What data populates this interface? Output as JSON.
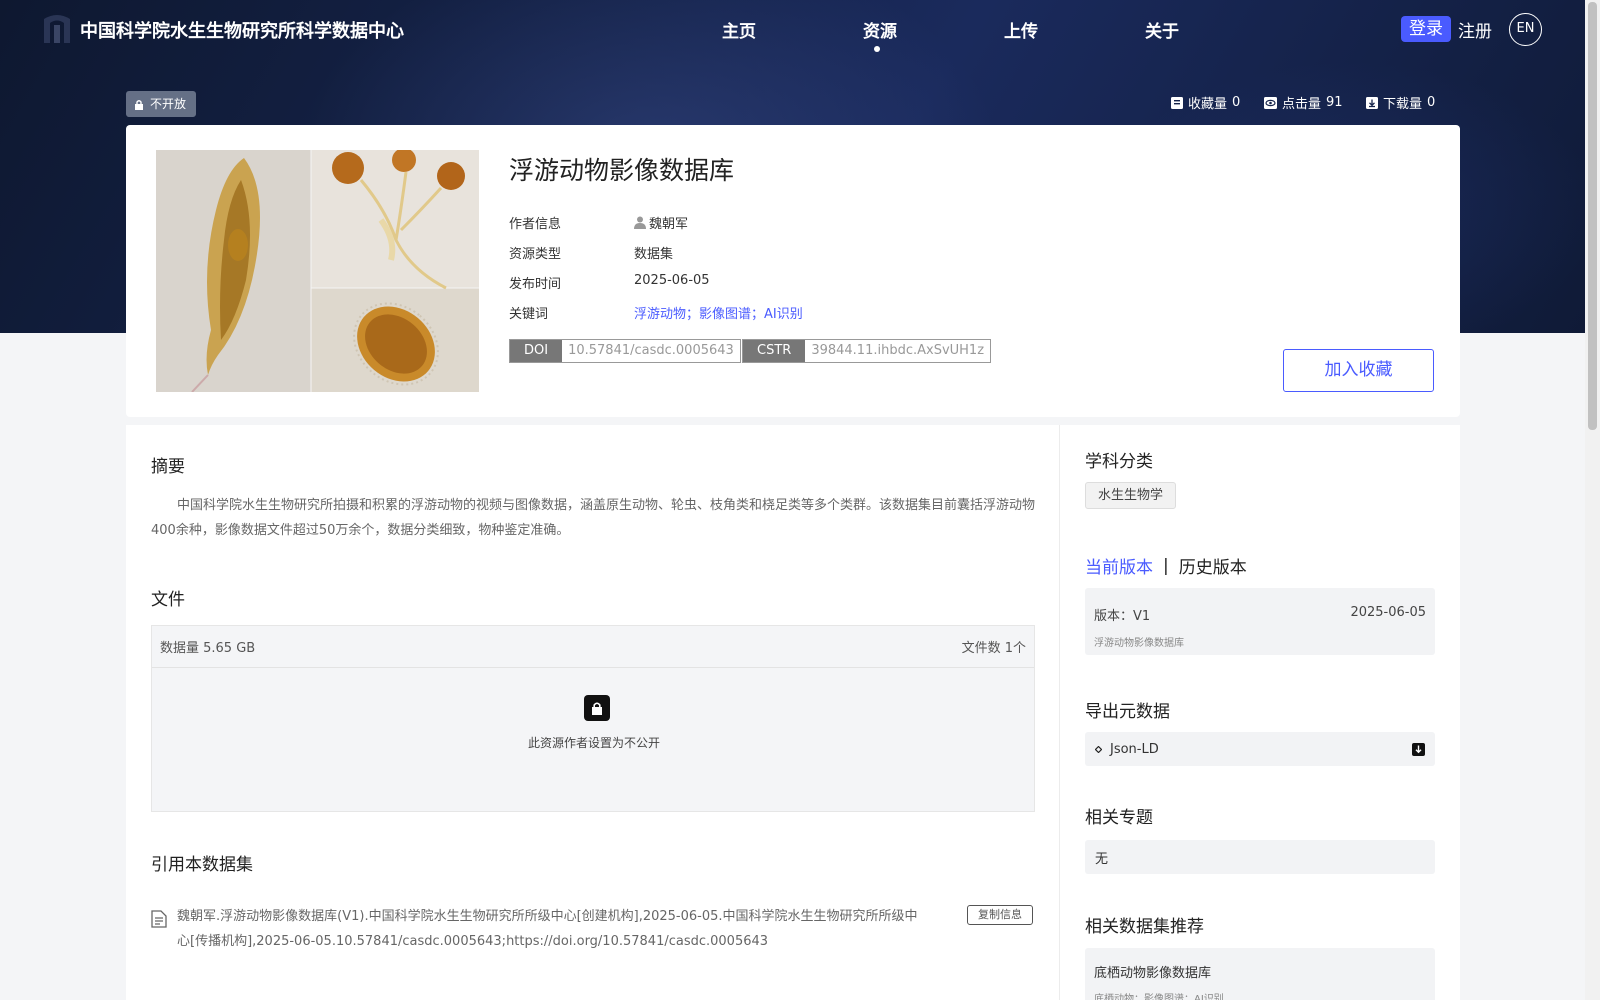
{
  "header": {
    "site_title": "中国科学院水生生物研究所科学数据中心",
    "nav": [
      "主页",
      "资源",
      "上传",
      "关于"
    ],
    "login": "登录",
    "register": "注册",
    "lang": "EN"
  },
  "resource": {
    "access_badge": "不开放",
    "stats": {
      "favorites_label": "收藏量",
      "favorites": "0",
      "clicks_label": "点击量",
      "clicks": "91",
      "downloads_label": "下载量",
      "downloads": "0"
    },
    "title": "浮游动物影像数据库",
    "meta": {
      "author_label": "作者信息",
      "author": "魏朝军",
      "type_label": "资源类型",
      "type": "数据集",
      "date_label": "发布时间",
      "date": "2025-06-05",
      "keywords_label": "关键词",
      "keywords": "浮游动物；影像图谱；AI识别"
    },
    "doi_label": "DOI",
    "doi": "10.57841/casdc.0005643",
    "cstr_label": "CSTR",
    "cstr": "39844.11.ihbdc.AxSvUH1z",
    "fav_button": "加入收藏"
  },
  "main": {
    "abstract_title": "摘要",
    "abstract": "中国科学院水生生物研究所拍摄和积累的浮游动物的视频与图像数据，涵盖原生动物、轮虫、枝角类和桡足类等多个类群。该数据集目前囊括浮游动物400余种，影像数据文件超过50万余个，数据分类细致，物种鉴定准确。",
    "files_title": "文件",
    "data_size": "数据量 5.65 GB",
    "file_count": "文件数 1个",
    "locked_text": "此资源作者设置为不公开",
    "cite_title": "引用本数据集",
    "citation": "魏朝军.浮游动物影像数据库(V1).中国科学院水生生物研究所所级中心[创建机构],2025-06-05.中国科学院水生生物研究所所级中心[传播机构],2025-06-05.10.57841/casdc.0005643;https://doi.org/10.57841/casdc.0005643",
    "copy_button": "复制信息"
  },
  "sidebar": {
    "subject_title": "学科分类",
    "subject": "水生生物学",
    "tab_current": "当前版本",
    "tab_sep": "|",
    "tab_history": "历史版本",
    "version_label": "版本：V1",
    "version_date": "2025-06-05",
    "version_name": "浮游动物影像数据库",
    "export_title": "导出元数据",
    "export_format": "Json-LD",
    "topics_title": "相关专题",
    "topics_value": "无",
    "recommend_title": "相关数据集推荐",
    "recommend_item_title": "底栖动物影像数据库",
    "recommend_item_tags": "底栖动物；影像图谱；AI识别"
  },
  "colors": {
    "accent": "#4a5bff",
    "hero": "#15234a"
  }
}
